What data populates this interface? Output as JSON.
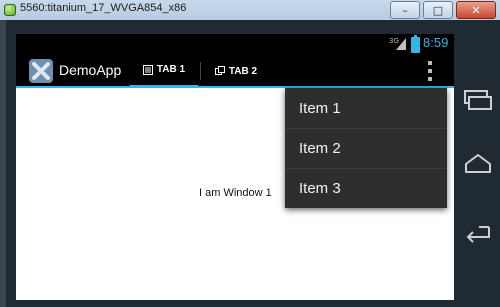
{
  "window": {
    "title": "5560:titanium_17_WVGA854_x86",
    "controls": {
      "minimize": "–",
      "maximize": "□",
      "close": "✕"
    }
  },
  "status_bar": {
    "network": "3G",
    "time": "8:59",
    "accent_color": "#33b5e5"
  },
  "action_bar": {
    "app_title": "DemoApp",
    "tabs": [
      {
        "label": "TAB 1",
        "selected": true
      },
      {
        "label": "TAB 2",
        "selected": false
      }
    ]
  },
  "content": {
    "text": "I am Window 1"
  },
  "menu": {
    "items": [
      "Item 1",
      "Item 2",
      "Item 3"
    ]
  },
  "nav": {
    "buttons": [
      "recent-apps-icon",
      "home-icon",
      "back-icon"
    ]
  }
}
